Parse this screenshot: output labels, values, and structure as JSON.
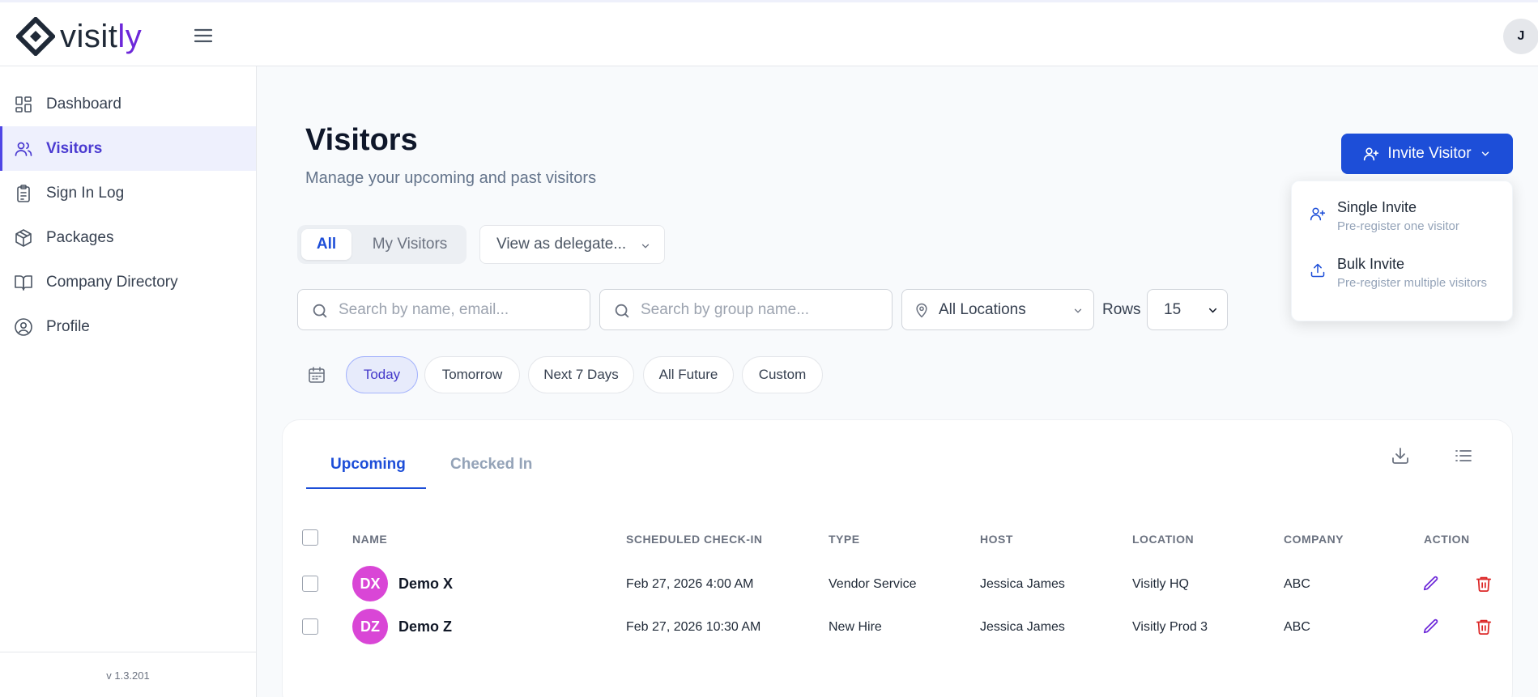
{
  "brand": {
    "logo_main": "visit",
    "logo_accent": "ly",
    "accent_color": "#6d28d9"
  },
  "user": {
    "initial": "J"
  },
  "sidebar": {
    "items": [
      {
        "label": "Dashboard",
        "icon": "dashboard-icon",
        "active": false
      },
      {
        "label": "Visitors",
        "icon": "users-icon",
        "active": true
      },
      {
        "label": "Sign In Log",
        "icon": "clipboard-icon",
        "active": false
      },
      {
        "label": "Packages",
        "icon": "package-icon",
        "active": false
      },
      {
        "label": "Company Directory",
        "icon": "book-icon",
        "active": false
      },
      {
        "label": "Profile",
        "icon": "user-circle-icon",
        "active": false
      }
    ],
    "version": "v 1.3.201"
  },
  "page": {
    "title": "Visitors",
    "subtitle": "Manage your upcoming and past visitors"
  },
  "invite": {
    "button_label": "Invite Visitor",
    "menu": [
      {
        "title": "Single Invite",
        "description": "Pre-register one visitor",
        "icon": "user-plus-icon"
      },
      {
        "title": "Bulk Invite",
        "description": "Pre-register multiple visitors",
        "icon": "upload-icon"
      }
    ]
  },
  "filters": {
    "segment": {
      "all": "All",
      "mine": "My Visitors",
      "selected": "All"
    },
    "delegate_placeholder": "View as delegate...",
    "search_name_placeholder": "Search by name, email...",
    "search_group_placeholder": "Search by group name...",
    "location": "All Locations",
    "rows_label": "Rows",
    "rows_value": "15",
    "date_chips": [
      "Today",
      "Tomorrow",
      "Next 7 Days",
      "All Future",
      "Custom"
    ],
    "date_selected": "Today"
  },
  "table": {
    "tabs": [
      "Upcoming",
      "Checked In"
    ],
    "active_tab": "Upcoming",
    "columns": [
      "NAME",
      "SCHEDULED CHECK-IN",
      "TYPE",
      "HOST",
      "LOCATION",
      "COMPANY",
      "ACTION"
    ],
    "rows": [
      {
        "initials": "DX",
        "name": "Demo X",
        "checkin": "Feb 27, 2026 4:00 AM",
        "type": "Vendor Service",
        "host": "Jessica James",
        "location": "Visitly HQ",
        "company": "ABC"
      },
      {
        "initials": "DZ",
        "name": "Demo Z",
        "checkin": "Feb 27, 2026 10:30 AM",
        "type": "New Hire",
        "host": "Jessica James",
        "location": "Visitly Prod 3",
        "company": "ABC"
      }
    ]
  },
  "colors": {
    "primary": "#1d4ed8",
    "avatar": "#d946d6",
    "delete": "#dc2626",
    "edit": "#6d28d9"
  }
}
